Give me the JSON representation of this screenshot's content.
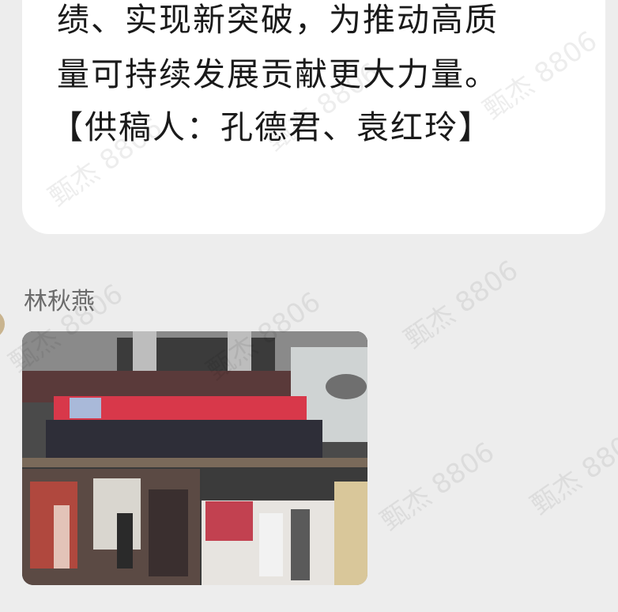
{
  "messages": [
    {
      "type": "text",
      "lines": [
        "绩、实现新突破，为推动高质",
        "量可持续发展贡献更大力量。",
        "【供稿人：孔德君、袁红玲】"
      ]
    },
    {
      "type": "image",
      "sender": "林秋燕"
    }
  ],
  "watermark": {
    "text": "甄杰 8806"
  },
  "colors": {
    "background": "#ededed",
    "bubble": "#ffffff",
    "text": "#1a1a1a",
    "sender": "#6b6b6b"
  }
}
